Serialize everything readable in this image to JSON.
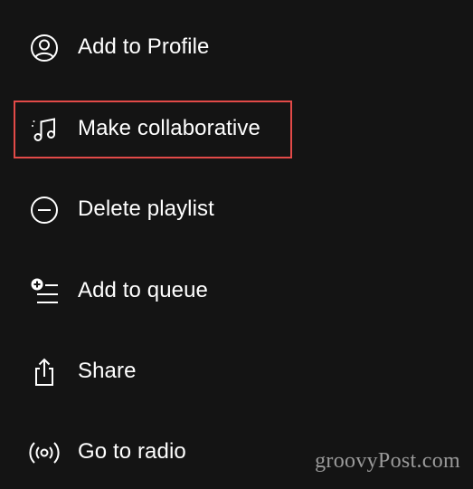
{
  "menu": {
    "items": [
      {
        "label": "Add to Profile",
        "icon": "profile-icon"
      },
      {
        "label": "Make collaborative",
        "icon": "music-note-icon"
      },
      {
        "label": "Delete playlist",
        "icon": "minus-circle-icon"
      },
      {
        "label": "Add to queue",
        "icon": "add-queue-icon"
      },
      {
        "label": "Share",
        "icon": "share-icon"
      },
      {
        "label": "Go to radio",
        "icon": "radio-icon"
      }
    ],
    "highlighted_index": 1
  },
  "watermark": "groovyPost.com",
  "colors": {
    "background": "#141414",
    "text": "#ffffff",
    "highlight": "#e24a48",
    "watermark": "#9a9a9a"
  }
}
